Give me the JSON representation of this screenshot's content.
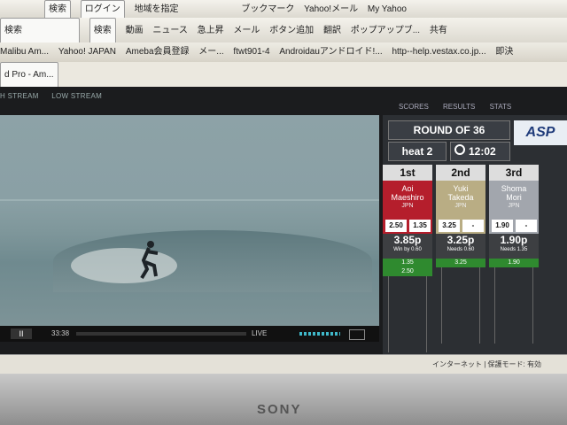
{
  "browser": {
    "toolbar1": [
      "検索",
      "ログイン",
      "地域を指定",
      "ブックマーク",
      "Yahoo!メール",
      "My Yahoo"
    ],
    "search_placeholder": "検索",
    "toolbar2": [
      "検索",
      "動画",
      "ニュース",
      "急上昇",
      "メール",
      "ボタン追加",
      "翻訳",
      "ポップアップブ...",
      "共有"
    ],
    "bookmarks": [
      "Malibu Am...",
      "Yahoo! JAPAN",
      "Ameba会員登録",
      "メー...",
      "ftwt901-4",
      "Androidauアンドロイド!...",
      "http--help.vestax.co.jp...",
      "即決"
    ],
    "tab": "d Pro - Am...",
    "status": [
      "インターネット | 保護モード: 有効"
    ]
  },
  "stream_tabs": [
    "H STREAM",
    "LOW STREAM"
  ],
  "top_tabs": [
    "SCORES",
    "RESULTS",
    "STATS"
  ],
  "player": {
    "time": "33:38",
    "live": "LIVE",
    "play": "II"
  },
  "panel": {
    "round": "ROUND OF 36",
    "heat": "heat  2",
    "clock": "12:02",
    "logo": "ASP"
  },
  "surfers": [
    {
      "rank": "1st",
      "first": "Aoi",
      "last": "Maeshiro",
      "country": "JPN",
      "waves": [
        "2.50",
        "1.35"
      ],
      "total": "3.85p",
      "note": "Win by  0.60",
      "req1": "1.35",
      "req2": "2.50"
    },
    {
      "rank": "2nd",
      "first": "Yuki",
      "last": "Takeda",
      "country": "JPN",
      "waves": [
        "3.25",
        "-"
      ],
      "total": "3.25p",
      "note": "Needs  0.60",
      "req1": "3.25",
      "req2": ""
    },
    {
      "rank": "3rd",
      "first": "Shoma",
      "last": "Mori",
      "country": "JPN",
      "waves": [
        "1.90",
        "-"
      ],
      "total": "1.90p",
      "note": "Needs  1.35",
      "req1": "1.90",
      "req2": ""
    }
  ],
  "brand": "SONY",
  "colors": {
    "first": "#b51e2c",
    "second": "#b9ad84",
    "third": "#a2a6ad"
  }
}
